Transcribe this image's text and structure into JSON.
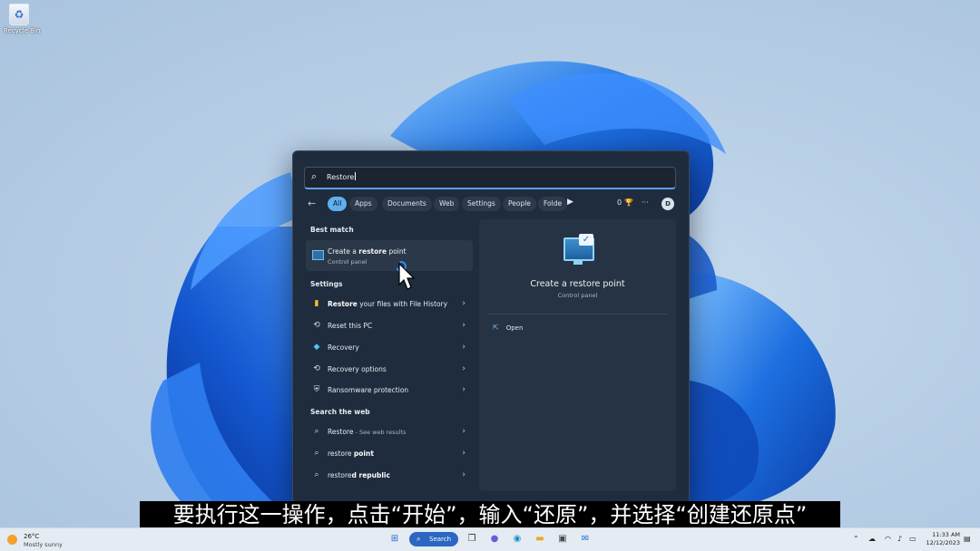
{
  "desktop": {
    "recycle_bin_label": "Recycle Bin"
  },
  "search": {
    "query": "Restore",
    "filters": [
      "All",
      "Apps",
      "Documents",
      "Web",
      "Settings",
      "People",
      "Folde"
    ],
    "result_count": "0",
    "avatar_initial": "D"
  },
  "best_match": {
    "heading": "Best match",
    "title_prefix": "Create a ",
    "title_bold": "restore",
    "title_suffix": " point",
    "subtitle": "Control panel"
  },
  "settings": {
    "heading": "Settings",
    "items": [
      {
        "bold": "Restore",
        "rest": " your files with File History"
      },
      {
        "bold": "",
        "rest": "Reset this PC"
      },
      {
        "bold": "",
        "rest": "Recovery"
      },
      {
        "bold": "",
        "rest": "Recovery options"
      },
      {
        "bold": "",
        "rest": "Ransomware protection"
      }
    ]
  },
  "web": {
    "heading": "Search the web",
    "items": [
      {
        "bold": "Restore",
        "rest": " - See web results"
      },
      {
        "bold": "restore ",
        "rest": "point"
      },
      {
        "bold": "restore",
        "rest": "d republic"
      }
    ]
  },
  "preview": {
    "title": "Create a restore point",
    "subtitle": "Control panel",
    "open_label": "Open"
  },
  "caption": "要执行这一操作，点击“开始”，输入“还原”，并选择“创建还原点”",
  "taskbar": {
    "temperature": "26°C",
    "weather": "Mostly sunny",
    "search_label": "Search",
    "time": "11:33 AM",
    "date": "12/12/2023"
  }
}
